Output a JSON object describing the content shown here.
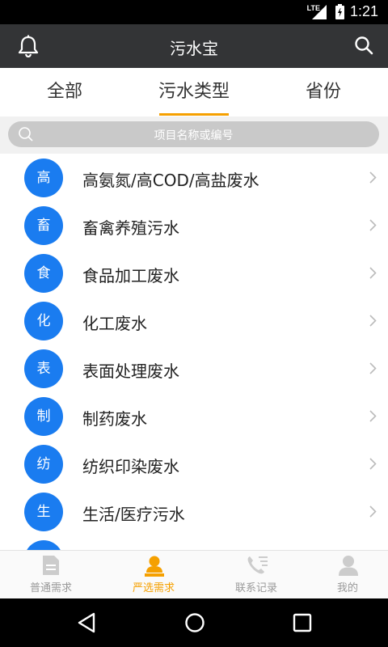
{
  "status_bar": {
    "time": "1:21",
    "network": "LTE"
  },
  "header": {
    "title": "污水宝",
    "bell_icon": "bell-icon",
    "search_icon": "search-icon"
  },
  "tabs": [
    {
      "label": "全部"
    },
    {
      "label": "污水类型"
    },
    {
      "label": "省份"
    }
  ],
  "active_tab": 1,
  "search": {
    "placeholder": "项目名称或编号"
  },
  "list": [
    {
      "badge": "高",
      "label": "高氨氮/高COD/高盐废水"
    },
    {
      "badge": "畜",
      "label": "畜禽养殖污水"
    },
    {
      "badge": "食",
      "label": "食品加工废水"
    },
    {
      "badge": "化",
      "label": "化工废水"
    },
    {
      "badge": "表",
      "label": "表面处理废水"
    },
    {
      "badge": "制",
      "label": "制药废水"
    },
    {
      "badge": "纺",
      "label": "纺织印染废水"
    },
    {
      "badge": "生",
      "label": "生活/医疗污水"
    },
    {
      "badge": "",
      "label": ""
    }
  ],
  "bottom_nav": [
    {
      "label": "普通需求",
      "icon": "document-icon"
    },
    {
      "label": "严选需求",
      "icon": "person-badge-icon"
    },
    {
      "label": "联系记录",
      "icon": "phone-list-icon"
    },
    {
      "label": "我的",
      "icon": "user-icon"
    }
  ],
  "active_nav": 1,
  "colors": {
    "header_bg": "#333436",
    "accent": "#f5a000",
    "badge_blue": "#1a7cf0",
    "search_bg": "#c9c9c9"
  }
}
